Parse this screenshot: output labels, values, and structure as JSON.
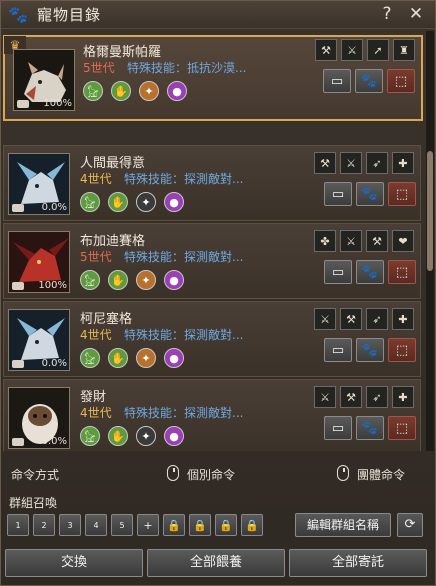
{
  "header": {
    "title": "寵物目錄",
    "help": "?",
    "close": "✕"
  },
  "pets": [
    {
      "name": "格爾曼斯帕羅",
      "gen": "5世代",
      "skill": "特殊技能：抵抗沙漠...",
      "pct": "100%",
      "selected": true,
      "circles": [
        "green",
        "green",
        "orange",
        "purple"
      ],
      "skills": [
        "🔨",
        "🐾",
        "⚔",
        "🟣"
      ]
    },
    {
      "name": "人間最得意",
      "gen": "4世代",
      "skill": "特殊技能：探測敵對...",
      "pct": "0.0%",
      "circles": [
        "green",
        "green",
        "gray",
        "purple"
      ],
      "skills": [
        "⚒",
        "⚔",
        "🪶",
        "✚"
      ]
    },
    {
      "name": "布加迪賽格",
      "gen": "5世代",
      "skill": "特殊技能：探測敵對...",
      "pct": "100%",
      "circles": [
        "green",
        "green",
        "orange",
        "purple"
      ],
      "skills": [
        "✤",
        "⚔",
        "⚒",
        "❤"
      ]
    },
    {
      "name": "柯尼塞格",
      "gen": "4世代",
      "skill": "特殊技能：探測敵對...",
      "pct": "0.0%",
      "circles": [
        "green",
        "green",
        "orange",
        "purple"
      ],
      "skills": [
        "⚔",
        "⚒",
        "🪶",
        "✚"
      ]
    },
    {
      "name": "發財",
      "gen": "4世代",
      "skill": "特殊技能：探測敵對...",
      "pct": "0.0%",
      "circles": [
        "green",
        "green",
        "gray",
        "purple"
      ],
      "skills": [
        "⚔",
        "⚒",
        "🪶",
        "✚"
      ]
    }
  ],
  "commands": {
    "mode_label": "命令方式",
    "individual": "個別命令",
    "group": "團體命令"
  },
  "group_summon": {
    "label": "群組召喚",
    "slots": [
      "1",
      "2",
      "3",
      "4",
      "5"
    ],
    "edit_label": "編輯群組名稱"
  },
  "bottom": {
    "exchange": "交換",
    "feed_all": "全部餵養",
    "entrust_all": "全部寄託"
  }
}
